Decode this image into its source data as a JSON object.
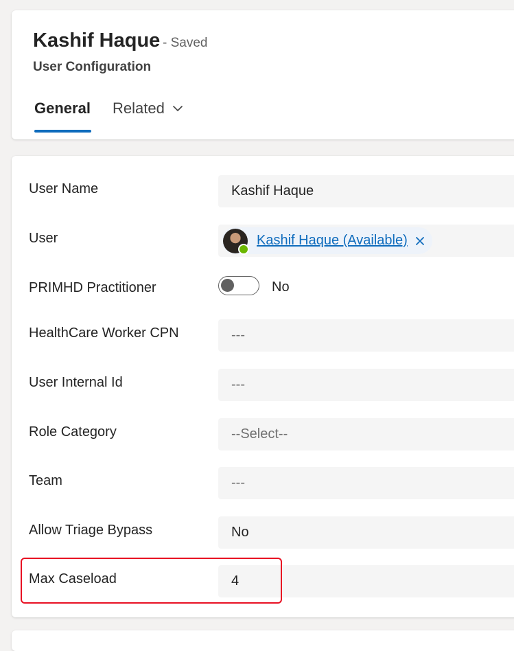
{
  "header": {
    "title": "Kashif Haque",
    "saved_status": "- Saved",
    "entity": "User Configuration"
  },
  "tabs": [
    {
      "label": "General",
      "selected": true
    },
    {
      "label": "Related",
      "has_dropdown": true
    }
  ],
  "form": {
    "user_name": {
      "label": "User Name",
      "value": "Kashif Haque"
    },
    "user": {
      "label": "User",
      "value": "Kashif Haque (Available)",
      "presence": "available",
      "presence_color": "#6bb700"
    },
    "primhd_practitioner": {
      "label": "PRIMHD Practitioner",
      "value": "No",
      "on": false
    },
    "healthcare_worker_cpn": {
      "label": "HealthCare Worker CPN",
      "value": "---"
    },
    "user_internal_id": {
      "label": "User Internal Id",
      "value": "---"
    },
    "role_category": {
      "label": "Role Category",
      "value": "--Select--"
    },
    "team": {
      "label": "Team",
      "value": "---"
    },
    "allow_triage_bypass": {
      "label": "Allow Triage Bypass",
      "value": "No"
    },
    "max_caseload": {
      "label": "Max Caseload",
      "value": "4"
    }
  },
  "colors": {
    "accent": "#0f6cbd",
    "highlight": "#e81123"
  },
  "icons": {
    "related_dropdown": "chevron-down-icon",
    "lookup_remove": "close-icon"
  }
}
